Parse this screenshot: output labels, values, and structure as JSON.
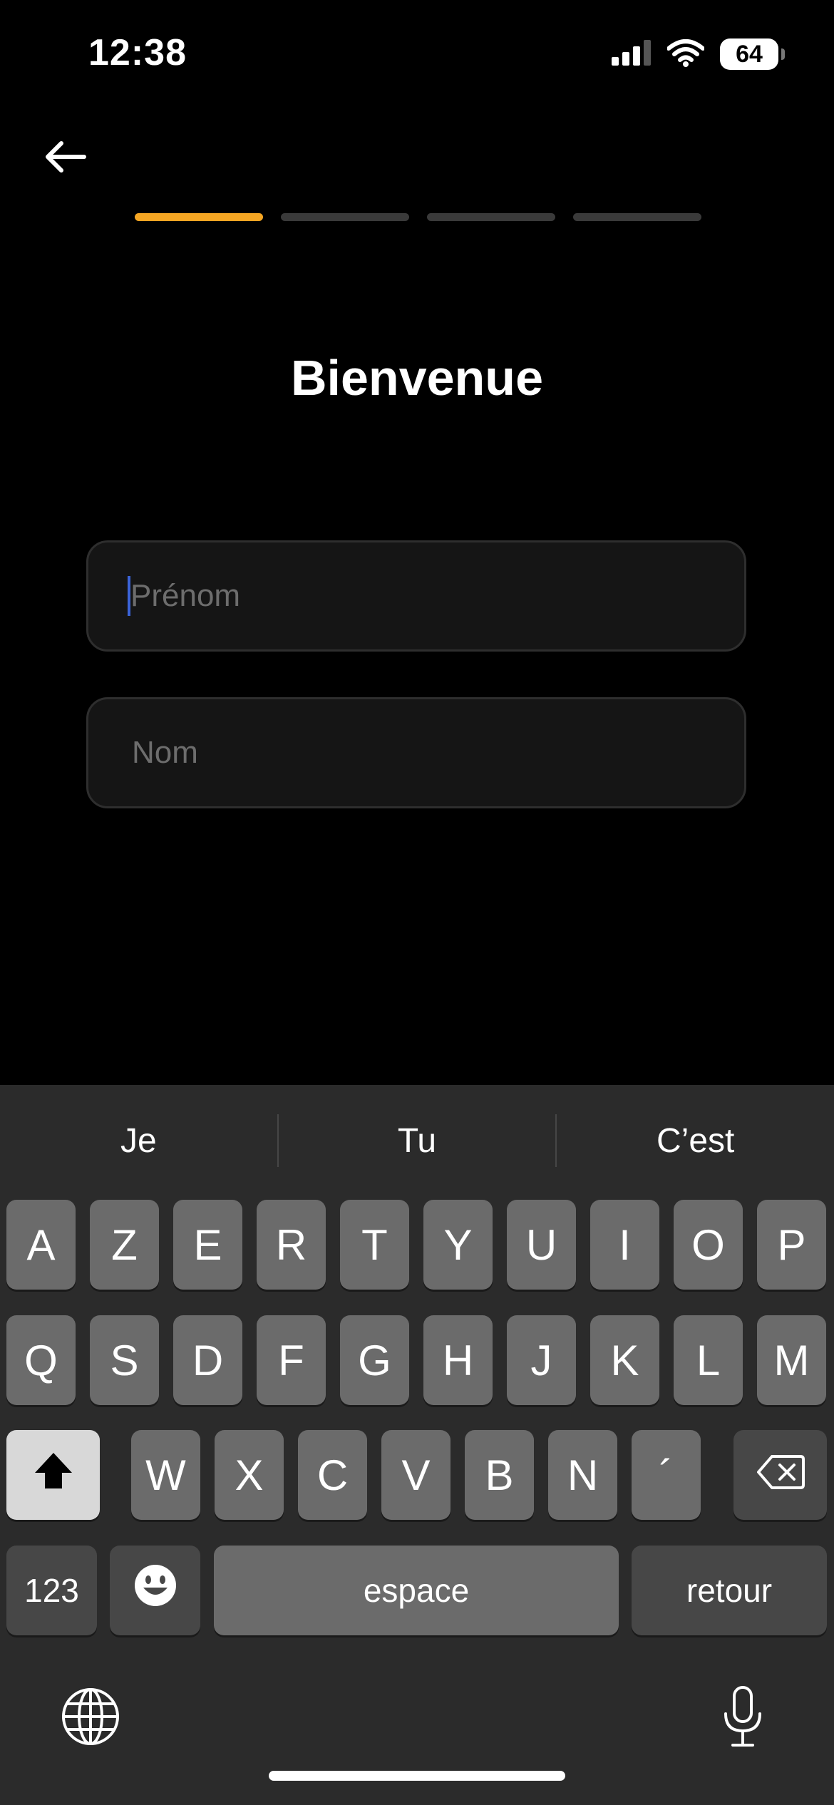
{
  "status_bar": {
    "time": "12:38",
    "battery": "64",
    "icons": [
      "signal-icon",
      "wifi-icon",
      "battery-icon"
    ]
  },
  "nav": {
    "back_icon": "arrow-left-icon"
  },
  "progress": {
    "steps_total": 4,
    "current_step": 1,
    "accent_color": "#F5A623"
  },
  "page": {
    "title": "Bienvenue"
  },
  "form": {
    "first_name_placeholder": "Prénom",
    "first_name_value": "",
    "last_name_placeholder": "Nom",
    "last_name_value": ""
  },
  "keyboard": {
    "suggestions": [
      "Je",
      "Tu",
      "C’est"
    ],
    "row1": [
      "A",
      "Z",
      "E",
      "R",
      "T",
      "Y",
      "U",
      "I",
      "O",
      "P"
    ],
    "row2": [
      "Q",
      "S",
      "D",
      "F",
      "G",
      "H",
      "J",
      "K",
      "L",
      "M"
    ],
    "row3": [
      "W",
      "X",
      "C",
      "V",
      "B",
      "N",
      "´"
    ],
    "numbers_label": "123",
    "space_label": "espace",
    "return_label": "retour",
    "icons": [
      "shift-icon",
      "backspace-icon",
      "emoji-icon",
      "globe-icon",
      "microphone-icon"
    ]
  }
}
